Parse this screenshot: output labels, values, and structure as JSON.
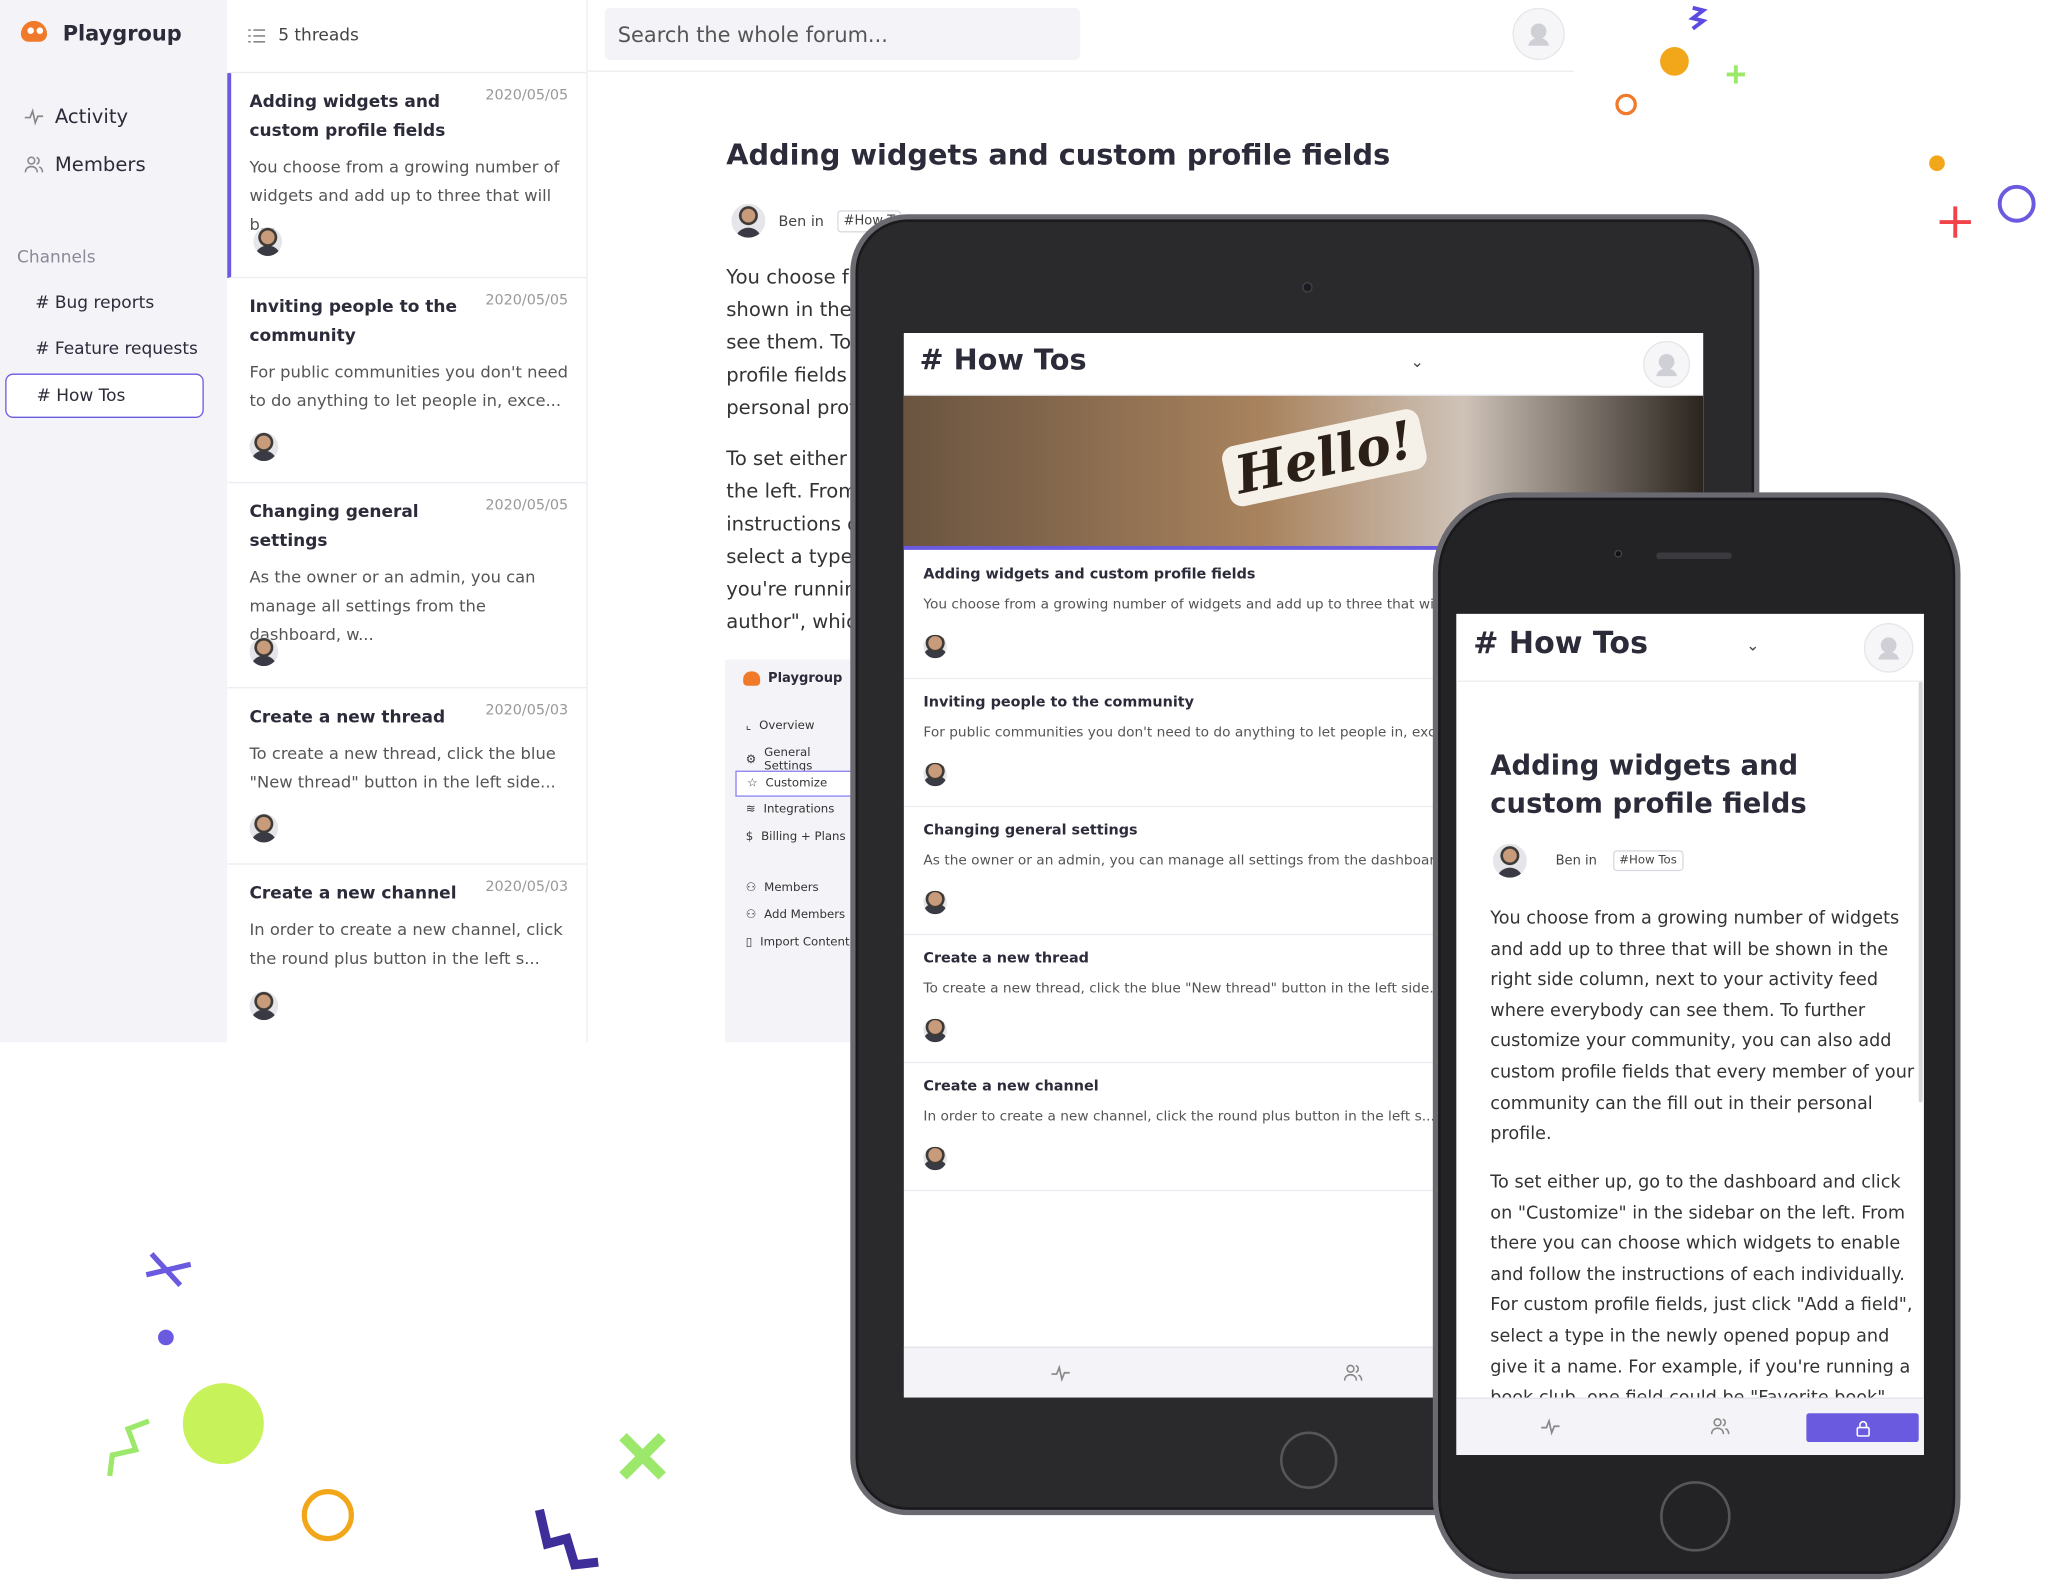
{
  "app": {
    "brand": "Playgroup"
  },
  "sidebar": {
    "nav": [
      {
        "label": "Activity",
        "icon": "activity-icon"
      },
      {
        "label": "Members",
        "icon": "members-icon"
      }
    ],
    "channels_heading": "Channels",
    "channels": [
      {
        "label": "# Bug reports"
      },
      {
        "label": "# Feature requests"
      },
      {
        "label": "# How Tos",
        "active": true
      }
    ]
  },
  "thread_list": {
    "count_label": "5 threads",
    "threads": [
      {
        "title": "Adding widgets and custom profile fields",
        "date": "2020/05/05",
        "excerpt": "You choose from a growing number of widgets and add up to three that will b..."
      },
      {
        "title": "Inviting people to the community",
        "date": "2020/05/05",
        "excerpt": "For public communities you don't need to do anything to let people in, exce..."
      },
      {
        "title": "Changing general settings",
        "date": "2020/05/05",
        "excerpt": "As the owner or an admin, you can manage all settings from the dashboard, w..."
      },
      {
        "title": "Create a new thread",
        "date": "2020/05/03",
        "excerpt": "To create a new thread, click the blue \"New thread\" button in the left side..."
      },
      {
        "title": "Create a new channel",
        "date": "2020/05/03",
        "excerpt": "In order to create a new channel, click the round plus button in the left s..."
      }
    ]
  },
  "search": {
    "placeholder": "Search the whole forum..."
  },
  "post": {
    "title": "Adding widgets and custom profile fields",
    "author_prefix": "Ben in",
    "tag": "#How T",
    "visible_lines": [
      "You choose fro",
      "shown in the r",
      "see them. To f",
      "profile fields th",
      "personal profi",
      "To set either u",
      "the left. From t",
      "instructions of",
      "select a type i",
      "you're running",
      "author\", which"
    ]
  },
  "mini_dashboard": {
    "brand": "Playgroup",
    "items": [
      "Overview",
      "General Settings",
      "Customize",
      "Integrations",
      "Billing + Plans",
      "Members",
      "Add Members",
      "Import Content"
    ]
  },
  "tablet": {
    "channel_title": "# How Tos",
    "banner_text": "Hello!",
    "threads": [
      {
        "title": "Adding widgets and custom profile fields",
        "excerpt": "You choose from a growing number of widgets and add up to three that wil"
      },
      {
        "title": "Inviting people to the community",
        "excerpt": "For public communities you don't need to do anything to let people in, exce"
      },
      {
        "title": "Changing general settings",
        "excerpt": "As the owner or an admin, you can manage all settings from the dashboard"
      },
      {
        "title": "Create a new thread",
        "excerpt": "To create a new thread, click the blue \"New thread\" button in the left side..."
      },
      {
        "title": "Create a new channel",
        "excerpt": "In order to create a new channel, click the round plus button in the left s..."
      }
    ]
  },
  "phone": {
    "channel_title": "# How Tos",
    "post_title_lines": [
      "Adding widgets and",
      "custom profile fields"
    ],
    "author_prefix": "Ben in",
    "tag": "#How Tos",
    "paragraph1": [
      "You choose from a growing number of widgets",
      "and add up to three that will be shown in the",
      "right side column, next to your activity feed",
      "where everybody can see them. To further",
      "customize your community, you can also add",
      "custom profile fields that every member of your",
      "community can the fill out in their personal",
      "profile."
    ],
    "paragraph2": [
      "To set either up, go to the dashboard and click",
      "on \"Customize\" in the sidebar on the left. From",
      "there you can choose which widgets to enable",
      "and follow the instructions of each individually.",
      "For custom profile fields, just click \"Add a field\",",
      "select a type in the newly opened popup and",
      "give it a name. For example, if you're running a",
      "book club, one field could be \"Favorite book\""
    ]
  },
  "colors": {
    "accent": "#6a5ae0",
    "brand_orange": "#f07a2a",
    "sidebar_bg": "#f4f3f7"
  }
}
